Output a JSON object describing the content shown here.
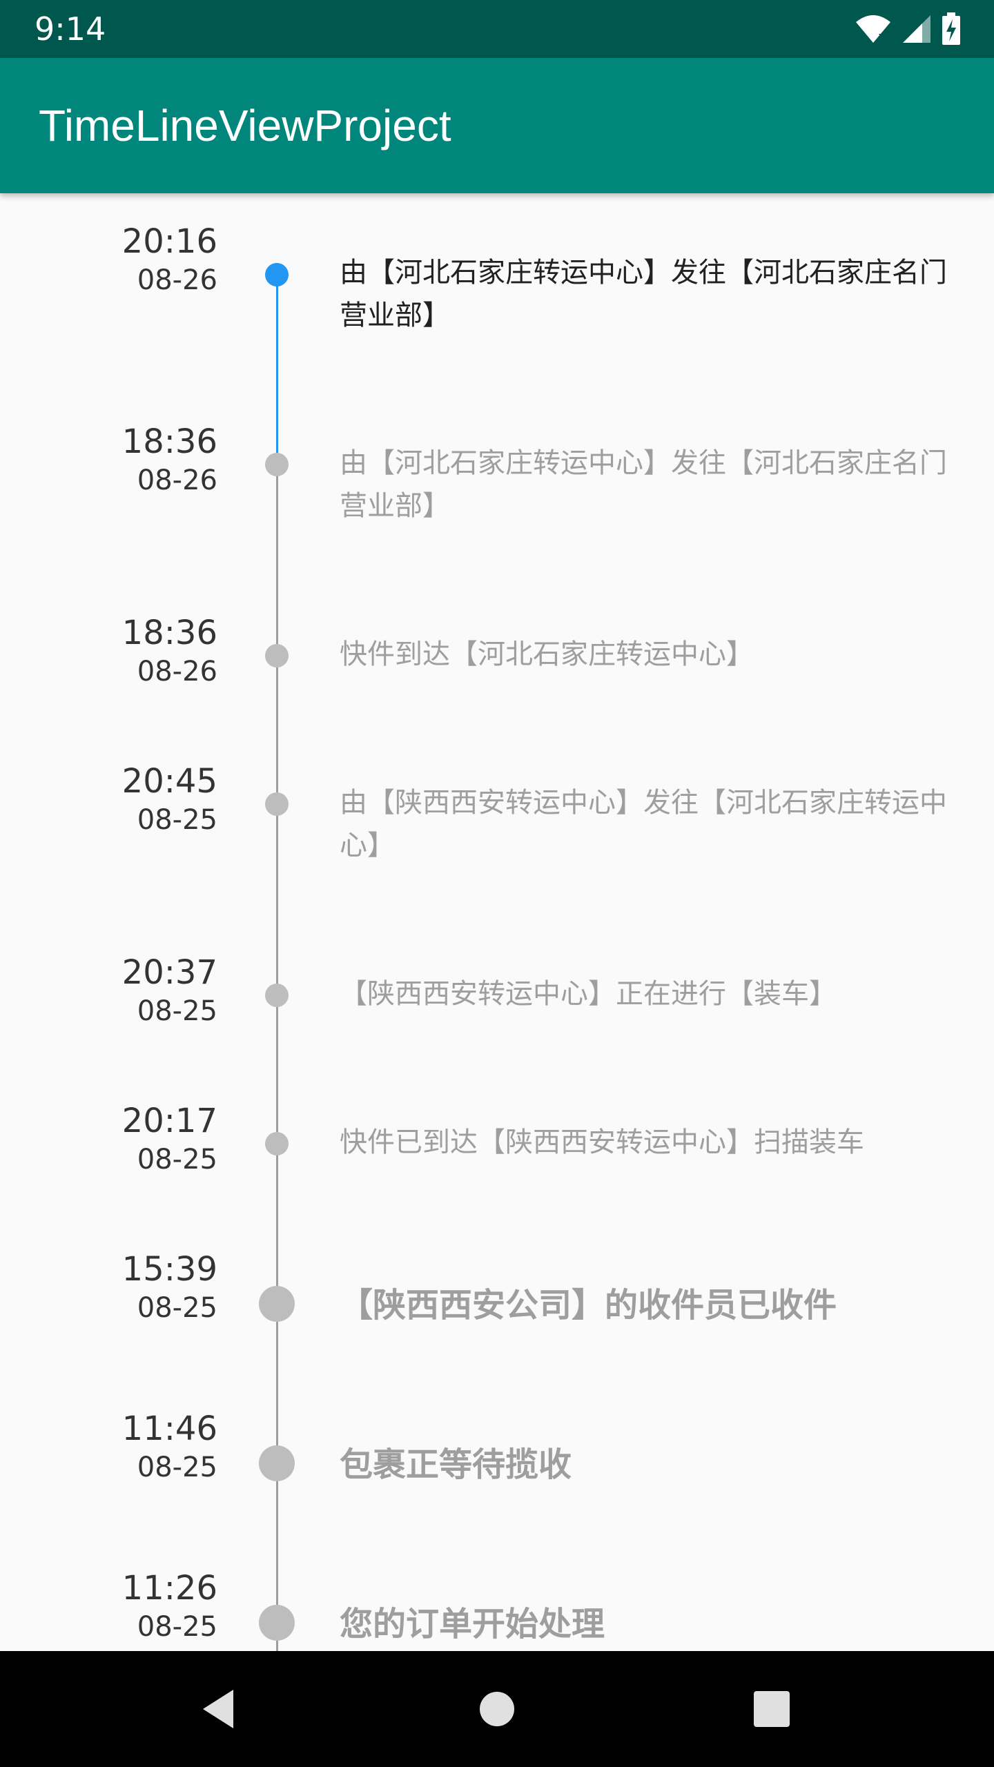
{
  "status_bar": {
    "time": "9:14",
    "icons": [
      "wifi-icon",
      "signal-icon",
      "battery-charging-icon"
    ]
  },
  "app_bar": {
    "title": "TimeLineViewProject"
  },
  "timeline": {
    "colors": {
      "active": "#2196f3",
      "inactive": "#bdbdbd",
      "line": "#9e9e9e"
    },
    "items": [
      {
        "time": "20:16",
        "date": "08-26",
        "text": "由【河北石家庄转运中心】发往【河北石家庄名门营业部】",
        "state": "active"
      },
      {
        "time": "18:36",
        "date": "08-26",
        "text": "由【河北石家庄转运中心】发往【河北石家庄名门营业部】",
        "state": "normal"
      },
      {
        "time": "18:36",
        "date": "08-26",
        "text": "快件到达【河北石家庄转运中心】",
        "state": "normal"
      },
      {
        "time": "20:45",
        "date": "08-25",
        "text": "由【陕西西安转运中心】发往【河北石家庄转运中心】",
        "state": "normal"
      },
      {
        "time": "20:37",
        "date": "08-25",
        "text": "【陕西西安转运中心】正在进行【装车】",
        "state": "normal"
      },
      {
        "time": "20:17",
        "date": "08-25",
        "text": "快件已到达【陕西西安转运中心】扫描装车",
        "state": "normal"
      },
      {
        "time": "15:39",
        "date": "08-25",
        "text": "【陕西西安公司】的收件员已收件",
        "state": "big"
      },
      {
        "time": "11:46",
        "date": "08-25",
        "text": "包裹正等待揽收",
        "state": "big"
      },
      {
        "time": "11:26",
        "date": "08-25",
        "text": "您的订单开始处理",
        "state": "big"
      }
    ]
  },
  "nav_bar": {
    "buttons": [
      "back-icon",
      "home-icon",
      "recents-icon"
    ]
  }
}
